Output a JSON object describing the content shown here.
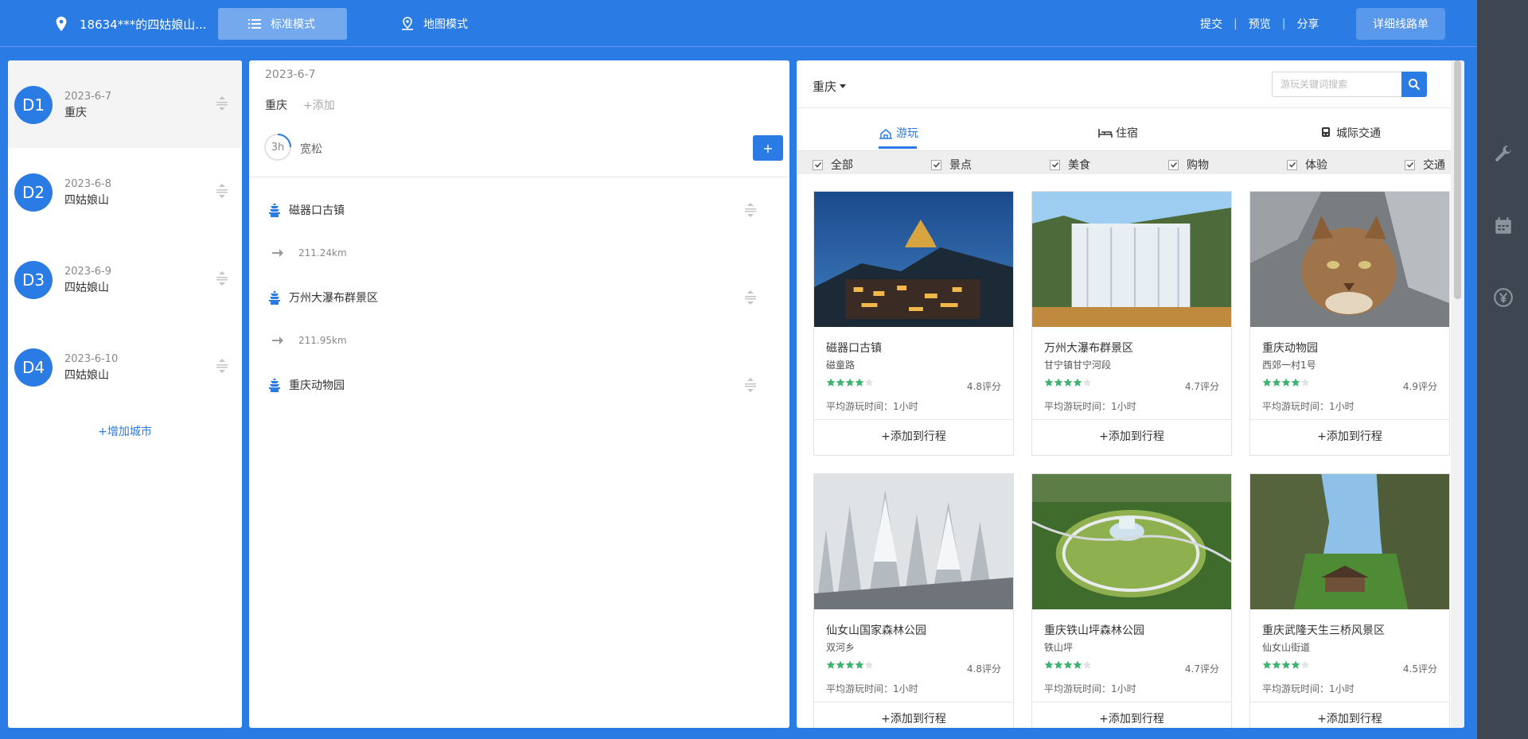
{
  "header": {
    "trip_name": "18634***的四姑娘山...",
    "mode_standard": "标准模式",
    "mode_map": "地图模式",
    "links": [
      "提交",
      "预览",
      "分享"
    ],
    "detail_button": "详细线路单"
  },
  "days": {
    "items": [
      {
        "badge": "D1",
        "date": "2023-6-7",
        "city": "重庆"
      },
      {
        "badge": "D2",
        "date": "2023-6-8",
        "city": "四姑娘山"
      },
      {
        "badge": "D3",
        "date": "2023-6-9",
        "city": "四姑娘山"
      },
      {
        "badge": "D4",
        "date": "2023-6-10",
        "city": "四姑娘山"
      }
    ],
    "add_city": "+增加城市"
  },
  "schedule": {
    "date": "2023-6-7",
    "city": "重庆",
    "add": "+添加",
    "duration": "3h",
    "pace": "宽松",
    "add_button": "+",
    "stops": [
      "磁器口古镇",
      "万州大瀑布群景区",
      "重庆动物园"
    ],
    "legs": [
      "211.24km",
      "211.95km"
    ]
  },
  "poi": {
    "city": "重庆",
    "search_placeholder": "游玩关键词搜索",
    "tabs": [
      "游玩",
      "住宿",
      "城际交通"
    ],
    "filters": [
      "全部",
      "景点",
      "美食",
      "购物",
      "体验",
      "交通"
    ],
    "cards": [
      {
        "name": "磁器口古镇",
        "address": "磁童路",
        "rating": 4,
        "score": "4.8评分",
        "time": "平均游玩时间：1小时",
        "button": "+添加到行程"
      },
      {
        "name": "万州大瀑布群景区",
        "address": "甘宁镇甘宁河段",
        "rating": 4,
        "score": "4.7评分",
        "time": "平均游玩时间：1小时",
        "button": "+添加到行程"
      },
      {
        "name": "重庆动物园",
        "address": "西郊一村1号",
        "rating": 4,
        "score": "4.9评分",
        "time": "平均游玩时间：1小时",
        "button": "+添加到行程"
      },
      {
        "name": "仙女山国家森林公园",
        "address": "双河乡",
        "rating": 4,
        "score": "4.8评分",
        "time": "平均游玩时间：1小时",
        "button": "+添加到行程"
      },
      {
        "name": "重庆铁山坪森林公园",
        "address": "铁山坪",
        "rating": 4,
        "score": "4.7评分",
        "time": "平均游玩时间：1小时",
        "button": "+添加到行程"
      },
      {
        "name": "重庆武隆天生三桥风景区",
        "address": "仙女山街道",
        "rating": 4,
        "score": "4.5评分",
        "time": "平均游玩时间：1小时",
        "button": "+添加到行程"
      }
    ]
  },
  "colors": {
    "brand": "#2a7be4",
    "rail": "#3e4751",
    "star": "#3cb371"
  }
}
